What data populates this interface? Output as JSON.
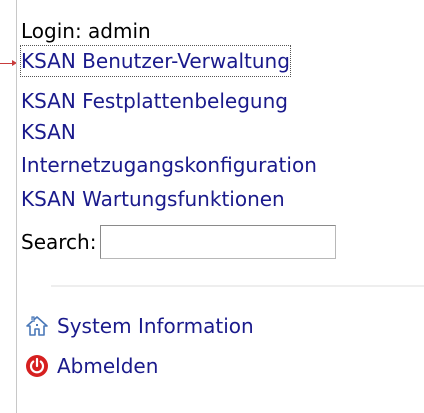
{
  "sidebar": {
    "login_text": "Login: admin",
    "links": [
      "KSAN Benutzer-Verwaltung",
      "KSAN Festplattenbelegung",
      "KSAN",
      "Internetzugangskonfiguration",
      "KSAN Wartungsfunktionen"
    ],
    "search_label": "Search:",
    "search_value": "",
    "nav": {
      "system_info": "System Information",
      "logout": "Abmelden"
    },
    "icons": {
      "system_info": "home-icon",
      "logout": "power-icon"
    },
    "colors": {
      "link": "#1a1a8c",
      "power": "#d62020",
      "home": "#4a78b8"
    }
  }
}
